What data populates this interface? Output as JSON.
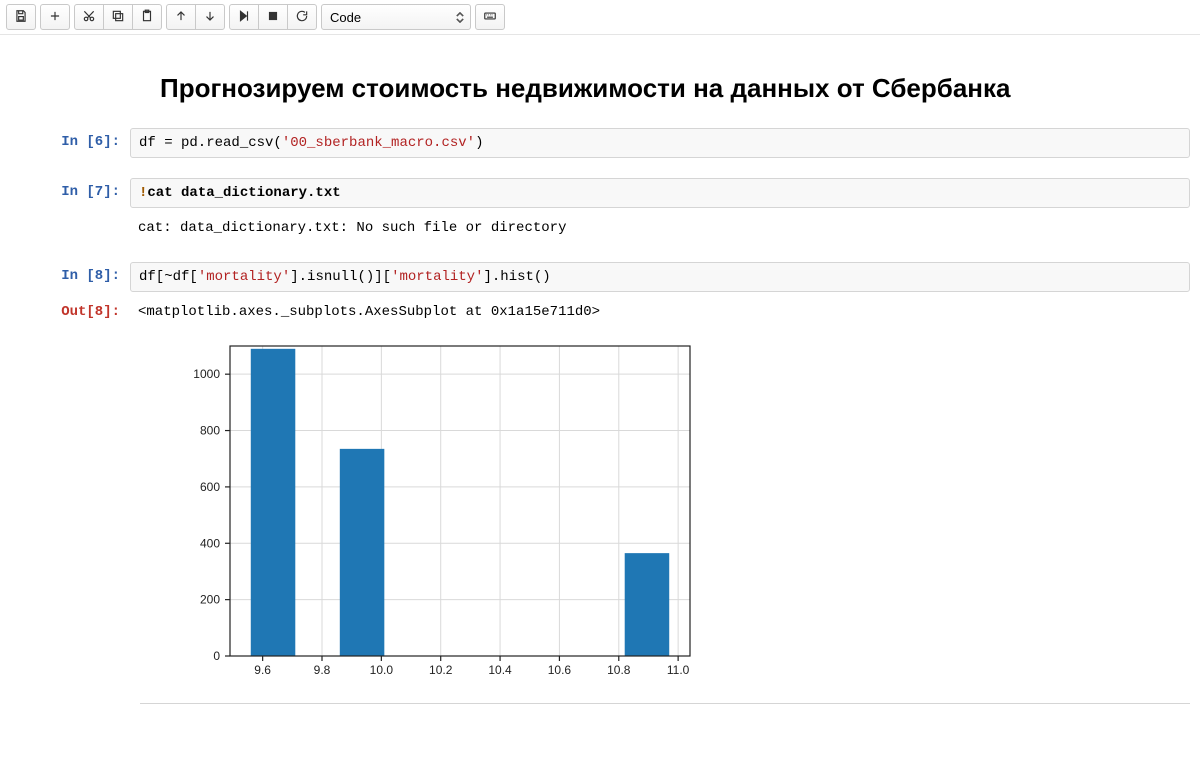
{
  "toolbar": {
    "cell_type_selected": "Code"
  },
  "notebook": {
    "title": "Прогнозируем стоимость недвижимости на данных от Сбербанка"
  },
  "cells": {
    "c6": {
      "prompt": "In [6]:",
      "code_prefix": "df = pd.read_csv(",
      "code_str": "'00_sberbank_macro.csv'",
      "code_suffix": ")"
    },
    "c7": {
      "prompt": "In [7]:",
      "bang": "!",
      "code": "cat data_dictionary.txt",
      "output": "cat: data_dictionary.txt: No such file or directory"
    },
    "c8": {
      "prompt": "In [8]:",
      "code_p1": "df[~df[",
      "code_s1": "'mortality'",
      "code_p2": "].isnull()][",
      "code_s2": "'mortality'",
      "code_p3": "].hist()",
      "out_prompt": "Out[8]:",
      "out_text": "<matplotlib.axes._subplots.AxesSubplot at 0x1a15e711d0>"
    }
  },
  "chart_data": {
    "type": "bar",
    "x_ticks": [
      9.6,
      9.8,
      10.0,
      10.2,
      10.4,
      10.6,
      10.8,
      11.0
    ],
    "y_ticks": [
      0,
      200,
      400,
      600,
      800,
      1000
    ],
    "bins": [
      {
        "left": 9.56,
        "right": 9.71,
        "count": 1090
      },
      {
        "left": 9.86,
        "right": 10.01,
        "count": 735
      },
      {
        "left": 10.82,
        "right": 10.97,
        "count": 365
      }
    ],
    "xlim": [
      9.49,
      11.04
    ],
    "ylim": [
      0,
      1100
    ],
    "title": "",
    "xlabel": "",
    "ylabel": ""
  }
}
